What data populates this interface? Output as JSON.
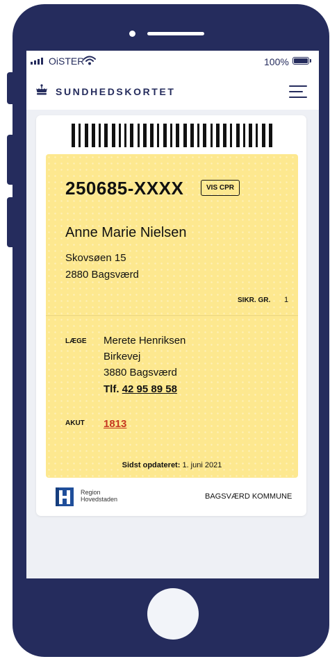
{
  "status_bar": {
    "carrier": "OiSTER",
    "battery_percent": "100%",
    "battery_level": 1.0,
    "signal_bars": 4
  },
  "app": {
    "title": "SUNDHEDSKORTET",
    "logo_icon": "crown-icon",
    "menu_icon": "hamburger-menu-icon"
  },
  "card": {
    "cpr": "250685-XXXX",
    "show_cpr_label": "VIS CPR",
    "name": "Anne Marie Nielsen",
    "address_line1": "Skovsøen 15",
    "address_line2": "2880 Bagsværd",
    "insurance_group_label": "SIKR. GR.",
    "insurance_group_value": "1",
    "doctor": {
      "label": "LÆGE",
      "name": "Merete Henriksen",
      "street": "Birkevej",
      "city": "3880 Bagsværd",
      "phone_label": "Tlf.",
      "phone": "42 95 89 58"
    },
    "emergency": {
      "label": "AKUT",
      "number": "1813"
    },
    "updated_label": "Sidst opdateret:",
    "updated_date": "1. juni 2021",
    "colors": {
      "card": "#fde88f",
      "accent": "#252c5d",
      "link_red": "#c5371f"
    }
  },
  "footer": {
    "region_line1": "Region",
    "region_line2": "Hovedstaden",
    "region_logo_text": "REGION",
    "municipality": "BAGSVÆRD KOMMUNE"
  }
}
